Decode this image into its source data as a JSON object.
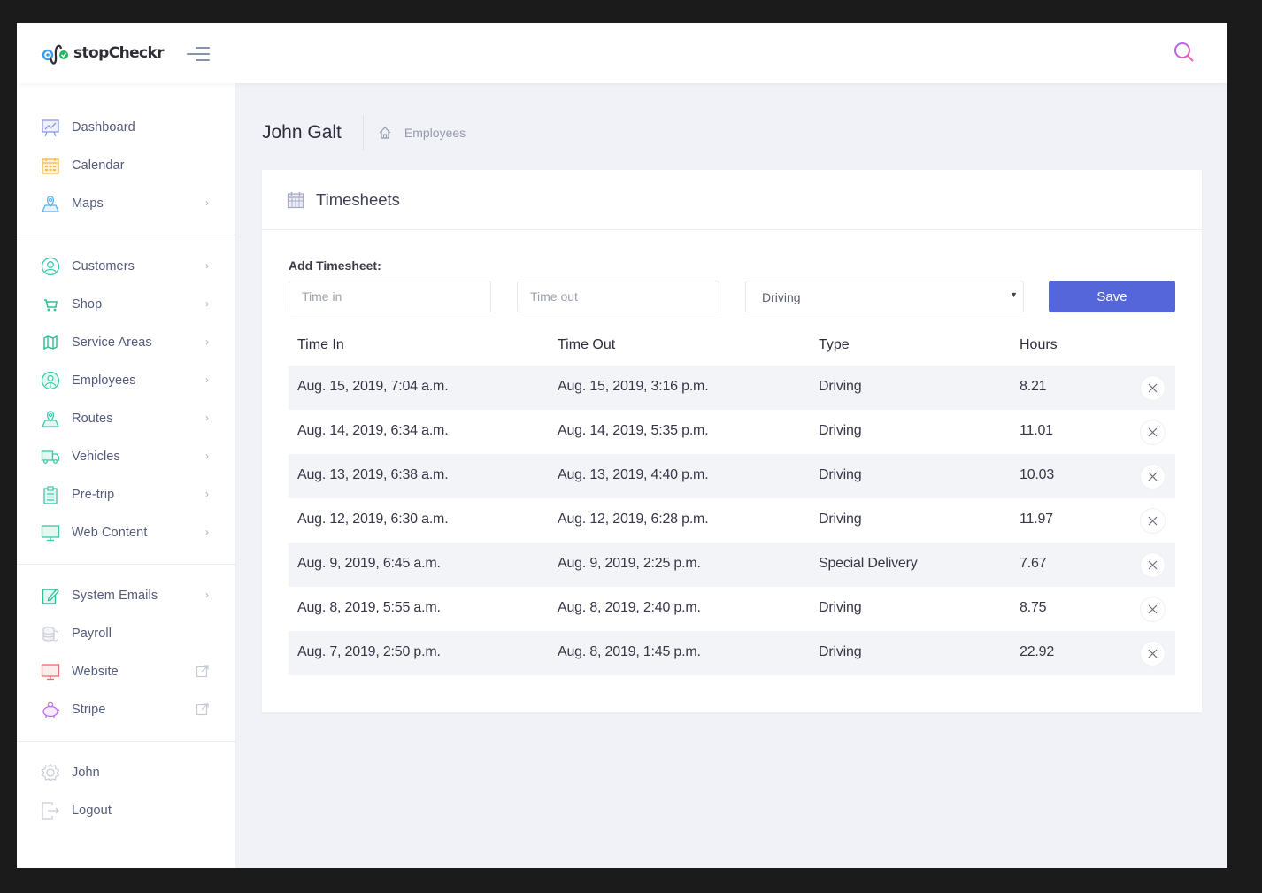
{
  "app": {
    "name": "stopCheckr",
    "brand_color": "#5566db"
  },
  "topbar": {
    "menu_icon": "hamburger-icon",
    "search_icon": "search-icon"
  },
  "sidebar": {
    "groups": [
      {
        "items": [
          {
            "label": "Dashboard",
            "icon": "dashboard-chart-icon",
            "chevron": false,
            "external": false
          },
          {
            "label": "Calendar",
            "icon": "calendar-icon",
            "chevron": false,
            "external": false
          },
          {
            "label": "Maps",
            "icon": "map-pin-icon",
            "chevron": true,
            "external": false
          }
        ]
      },
      {
        "items": [
          {
            "label": "Customers",
            "icon": "user-circle-icon",
            "chevron": true,
            "external": false
          },
          {
            "label": "Shop",
            "icon": "cart-icon",
            "chevron": true,
            "external": false
          },
          {
            "label": "Service Areas",
            "icon": "map-icon",
            "chevron": true,
            "external": false
          },
          {
            "label": "Employees",
            "icon": "employee-icon",
            "chevron": true,
            "external": false
          },
          {
            "label": "Routes",
            "icon": "route-pin-icon",
            "chevron": true,
            "external": false
          },
          {
            "label": "Vehicles",
            "icon": "truck-icon",
            "chevron": true,
            "external": false
          },
          {
            "label": "Pre-trip",
            "icon": "clipboard-icon",
            "chevron": true,
            "external": false
          },
          {
            "label": "Web Content",
            "icon": "monitor-icon",
            "chevron": true,
            "external": false
          }
        ]
      },
      {
        "items": [
          {
            "label": "System Emails",
            "icon": "edit-note-icon",
            "chevron": true,
            "external": false
          },
          {
            "label": "Payroll",
            "icon": "coins-icon",
            "chevron": false,
            "external": false
          },
          {
            "label": "Website",
            "icon": "monitor-icon",
            "chevron": false,
            "external": true
          },
          {
            "label": "Stripe",
            "icon": "piggy-bank-icon",
            "chevron": false,
            "external": true
          }
        ]
      },
      {
        "items": [
          {
            "label": "John",
            "icon": "gear-icon",
            "chevron": false,
            "external": false
          },
          {
            "label": "Logout",
            "icon": "logout-icon",
            "chevron": false,
            "external": false
          }
        ]
      }
    ]
  },
  "page": {
    "title": "John Galt",
    "breadcrumb": {
      "home_icon": "home-icon",
      "items": [
        "Employees"
      ]
    }
  },
  "card": {
    "title": "Timesheets",
    "icon": "calendar-icon",
    "form": {
      "label": "Add Timesheet:",
      "time_in_placeholder": "Time in",
      "time_out_placeholder": "Time out",
      "type_selected": "Driving",
      "save_label": "Save"
    },
    "table": {
      "columns": [
        "Time In",
        "Time Out",
        "Type",
        "Hours"
      ],
      "rows": [
        {
          "time_in": "Aug. 15, 2019, 7:04 a.m.",
          "time_out": "Aug. 15, 2019, 3:16 p.m.",
          "type": "Driving",
          "hours": "8.21"
        },
        {
          "time_in": "Aug. 14, 2019, 6:34 a.m.",
          "time_out": "Aug. 14, 2019, 5:35 p.m.",
          "type": "Driving",
          "hours": "11.01"
        },
        {
          "time_in": "Aug. 13, 2019, 6:38 a.m.",
          "time_out": "Aug. 13, 2019, 4:40 p.m.",
          "type": "Driving",
          "hours": "10.03"
        },
        {
          "time_in": "Aug. 12, 2019, 6:30 a.m.",
          "time_out": "Aug. 12, 2019, 6:28 p.m.",
          "type": "Driving",
          "hours": "11.97"
        },
        {
          "time_in": "Aug. 9, 2019, 6:45 a.m.",
          "time_out": "Aug. 9, 2019, 2:25 p.m.",
          "type": "Special Delivery",
          "hours": "7.67"
        },
        {
          "time_in": "Aug. 8, 2019, 5:55 a.m.",
          "time_out": "Aug. 8, 2019, 2:40 p.m.",
          "type": "Driving",
          "hours": "8.75"
        },
        {
          "time_in": "Aug. 7, 2019, 2:50 p.m.",
          "time_out": "Aug. 8, 2019, 1:45 p.m.",
          "type": "Driving",
          "hours": "22.92"
        }
      ]
    }
  }
}
